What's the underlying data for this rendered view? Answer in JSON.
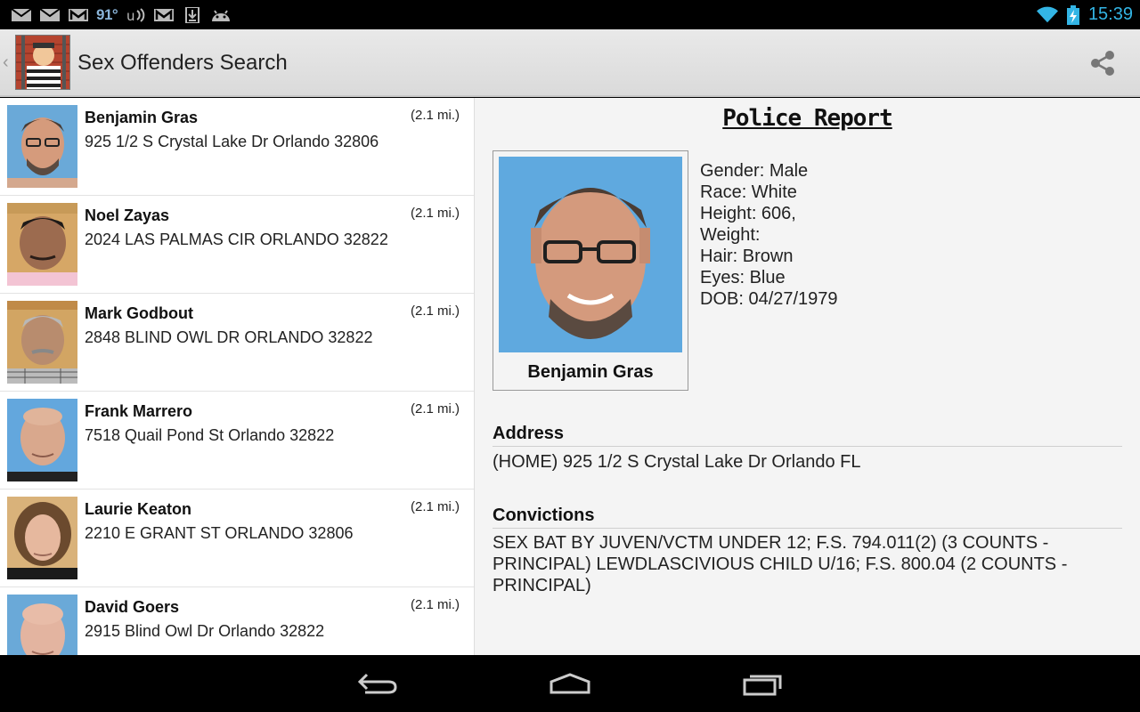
{
  "status": {
    "temperature": "91°",
    "time": "15:39"
  },
  "app": {
    "title": "Sex Offenders Search"
  },
  "offenders": [
    {
      "name": "Benjamin Gras",
      "address": "925 1/2 S Crystal Lake Dr Orlando 32806",
      "distance": "(2.1 mi.)"
    },
    {
      "name": "Noel Zayas",
      "address": "2024 LAS PALMAS CIR ORLANDO 32822",
      "distance": "(2.1 mi.)"
    },
    {
      "name": "Mark Godbout",
      "address": "2848 BLIND OWL DR ORLANDO 32822",
      "distance": "(2.1 mi.)"
    },
    {
      "name": "Frank Marrero",
      "address": "7518 Quail Pond St Orlando 32822",
      "distance": "(2.1 mi.)"
    },
    {
      "name": "Laurie Keaton",
      "address": "2210 E GRANT ST ORLANDO 32806",
      "distance": "(2.1 mi.)"
    },
    {
      "name": "David Goers",
      "address": "2915 Blind Owl Dr Orlando 32822",
      "distance": "(2.1 mi.)"
    }
  ],
  "detail": {
    "report_title": "Police Report",
    "name": "Benjamin Gras",
    "gender": "Gender: Male",
    "race": "Race: White",
    "height": "Height: 606,",
    "weight": "Weight:",
    "hair": "Hair: Brown",
    "eyes": "Eyes: Blue",
    "dob": "DOB: 04/27/1979",
    "address_label": "Address",
    "address": "(HOME) 925 1/2 S Crystal Lake Dr Orlando FL",
    "convictions_label": "Convictions",
    "convictions": "SEX BAT BY JUVEN/VCTM UNDER 12; F.S. 794.011(2) (3 COUNTS - PRINCIPAL) LEWDLASCIVIOUS CHILD U/16; F.S. 800.04 (2 COUNTS - PRINCIPAL)"
  },
  "colors": {
    "accent": "#33b5e5",
    "actionbar": "#e2e2e2"
  }
}
